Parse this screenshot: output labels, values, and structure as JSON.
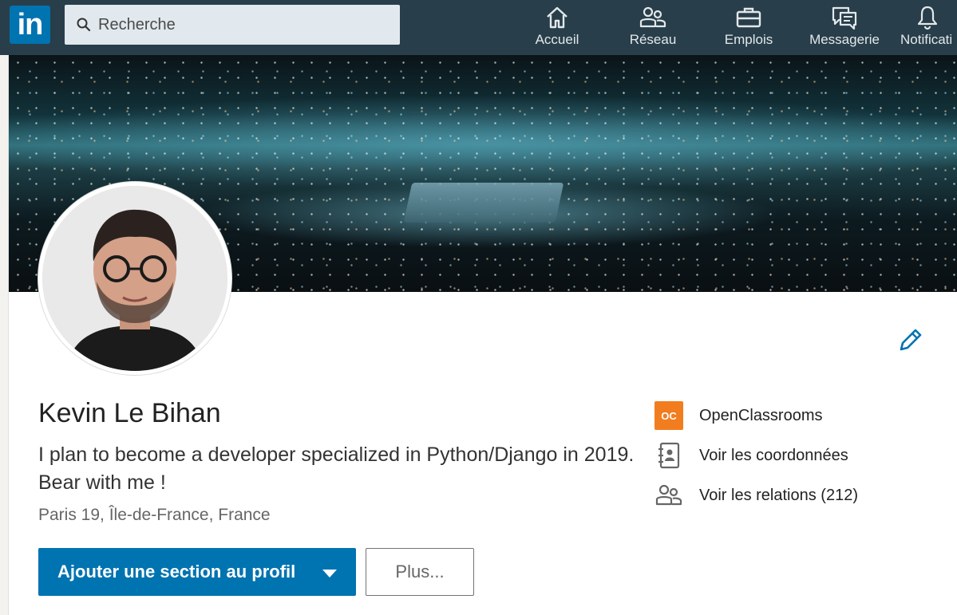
{
  "header": {
    "logo_text": "in",
    "search_placeholder": "Recherche",
    "nav": [
      {
        "label": "Accueil",
        "icon": "home-icon"
      },
      {
        "label": "Réseau",
        "icon": "people-icon"
      },
      {
        "label": "Emplois",
        "icon": "briefcase-icon"
      },
      {
        "label": "Messagerie",
        "icon": "messaging-icon"
      },
      {
        "label": "Notificati",
        "icon": "bell-icon"
      }
    ]
  },
  "profile": {
    "name": "Kevin Le Bihan",
    "headline": "I plan to become a developer specialized in Python/Django in 2019. Bear with me !",
    "location": "Paris 19, Île-de-France, France",
    "primary_action": "Ajouter une section au profil",
    "secondary_action": "Plus...",
    "side": {
      "company": "OpenClassrooms",
      "company_logo_text": "OC",
      "contact": "Voir les coordonnées",
      "connections": "Voir les relations (212)"
    }
  },
  "colors": {
    "topbar": "#283e4a",
    "brand": "#0073b1",
    "openclassrooms": "#f27d1f"
  }
}
